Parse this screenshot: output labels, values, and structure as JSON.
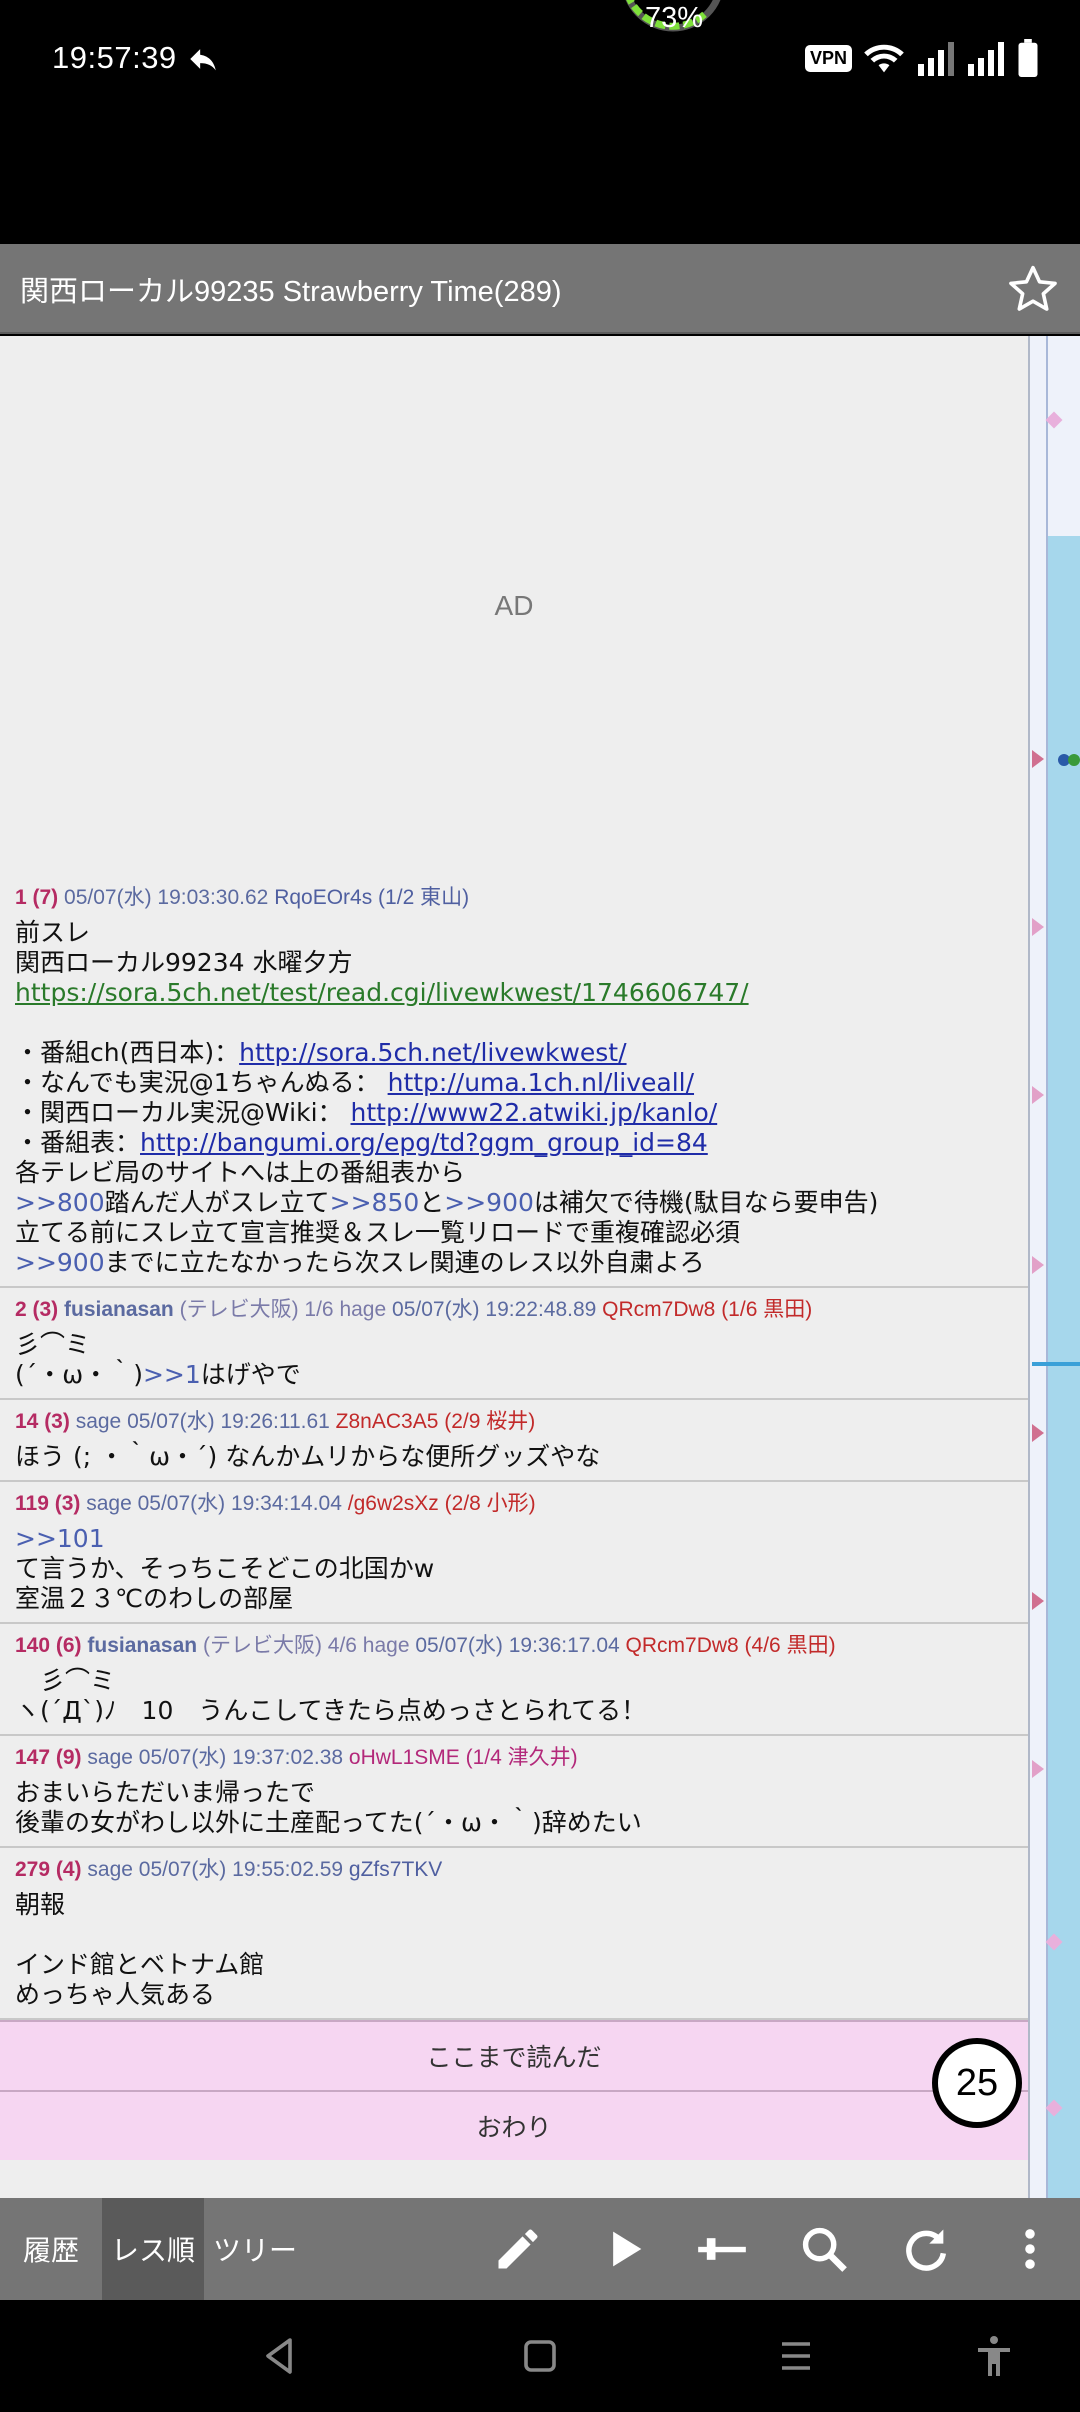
{
  "status": {
    "time": "19:57:39",
    "battery_percent": "73%",
    "vpn_label": "VPN"
  },
  "header": {
    "title": "関西ローカル99235 Strawberry Time(289)"
  },
  "ad_label": "AD",
  "posts": [
    {
      "num": "1 (7)",
      "meta": "05/07(水) 19:03:30.62",
      "uid": "RqoEOr4s (1/2 東山)",
      "body_lines": [
        {
          "t": "前スレ"
        },
        {
          "t": "関西ローカル99234 水曜夕方"
        },
        {
          "t": "https://sora.5ch.net/test/read.cgi/livewkwest/1746606747/",
          "k": "lnk-g"
        },
        {
          "t": ""
        },
        {
          "t": "・番組ch(西日本)：",
          "link": "http://sora.5ch.net/livewkwest/"
        },
        {
          "t": "・なんでも実況@1ちゃんぬる： ",
          "link": "http://uma.1ch.nl/liveall/"
        },
        {
          "t": "・関西ローカル実況@Wiki： ",
          "link": "http://www22.atwiki.jp/kanlo/"
        },
        {
          "t": "・番組表：",
          "link": "http://bangumi.org/epg/td?ggm_group_id=84"
        },
        {
          "t": "各テレビ局のサイトへは上の番組表から"
        },
        {
          "t": "",
          "parts": [
            {
              "a": ">>800"
            },
            {
              "s": "踏んだ人がスレ立て"
            },
            {
              "a": ">>850"
            },
            {
              "s": "と"
            },
            {
              "a": ">>900"
            },
            {
              "s": "は補欠で待機(駄目なら要申告)"
            }
          ]
        },
        {
          "t": "立てる前にスレ立て宣言推奨＆スレ一覧リロードで重複確認必須"
        },
        {
          "t": "",
          "parts": [
            {
              "a": ">>900"
            },
            {
              "s": "までに立たなかったら次スレ関連のレス以外自粛よろ"
            }
          ]
        }
      ]
    },
    {
      "num": "2 (3)",
      "name": "fusianasan",
      "src": "(テレビ大阪) 1/6 hage",
      "meta": "05/07(水) 19:22:48.89",
      "uid": "QRcm7Dw8 (1/6 黒田)",
      "uid_class": "uid-red",
      "body_lines": [
        {
          "t": "彡⌒ミ"
        },
        {
          "t": "",
          "parts": [
            {
              "s": "(´・ω・｀)"
            },
            {
              "a": ">>1"
            },
            {
              "s": "はげやで"
            }
          ]
        }
      ]
    },
    {
      "num": "14 (3)",
      "meta": "sage 05/07(水) 19:26:11.61",
      "uid": "Z8nAC3A5 (2/9 桜井)",
      "uid_class": "uid-red",
      "body_lines": [
        {
          "t": "ほう (; ・｀ω・´) なんかムリからな便所グッズやな"
        }
      ]
    },
    {
      "num": "119 (3)",
      "meta": "sage 05/07(水) 19:34:14.04",
      "uid": "/g6w2sXz (2/8 小形)",
      "uid_class": "uid-red",
      "body_lines": [
        {
          "t": "",
          "parts": [
            {
              "a": ">>101"
            }
          ]
        },
        {
          "t": "て言うか、そっちこそどこの北国かw"
        },
        {
          "t": "室温２３℃のわしの部屋"
        }
      ]
    },
    {
      "num": "140 (6)",
      "name": "fusianasan",
      "src": "(テレビ大阪) 4/6 hage",
      "meta": "05/07(水) 19:36:17.04",
      "uid": "QRcm7Dw8 (4/6 黒田)",
      "uid_class": "uid-red",
      "body_lines": [
        {
          "t": "　彡⌒ミ"
        },
        {
          "t": "ヽ(´Д`)ﾉ　10　うんこしてきたら点めっさとられてる！"
        }
      ]
    },
    {
      "num": "147 (9)",
      "meta": "sage 05/07(水) 19:37:02.38",
      "uid": "oHwL1SME (1/4 津久井)",
      "uid_class": "uid-pink",
      "body_lines": [
        {
          "t": "おまいらただいま帰ったで"
        },
        {
          "t": "後輩の女がわし以外に土産配ってた(´・ω・｀)辞めたい"
        }
      ]
    },
    {
      "num": "279 (4)",
      "meta": "sage 05/07(水) 19:55:02.59",
      "uid": "gZfs7TKV",
      "uid_class": "uid-blue",
      "body_lines": [
        {
          "t": "朝報"
        },
        {
          "t": ""
        },
        {
          "t": "インド館とベトナム館"
        },
        {
          "t": "めっちゃ人気ある"
        }
      ]
    }
  ],
  "read_marker": "ここまで読んだ",
  "end_label": "おわり",
  "new_count": "25",
  "toolbar": {
    "tab_history": "履歴",
    "tab_order": "レス順",
    "tab_tree": "ツリー"
  }
}
